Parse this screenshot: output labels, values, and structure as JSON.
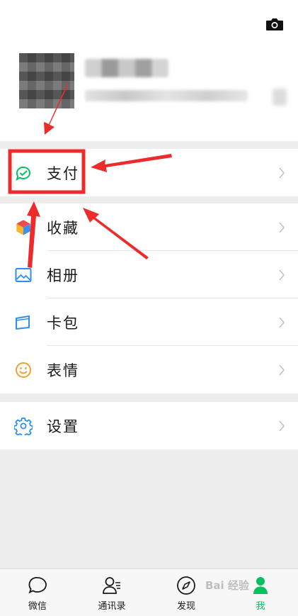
{
  "profile": {
    "camera_icon": "camera-icon"
  },
  "menu": {
    "pay_label": "支付",
    "favorites_label": "收藏",
    "album_label": "相册",
    "cards_label": "卡包",
    "stickers_label": "表情",
    "settings_label": "设置"
  },
  "tabbar": {
    "chats": "微信",
    "contacts": "通讯录",
    "discover": "发现",
    "me": "我"
  },
  "colors": {
    "accent_green": "#07c160",
    "highlight_red": "#ee2b2b",
    "background": "#ededed"
  },
  "watermark": "Bai 经验"
}
